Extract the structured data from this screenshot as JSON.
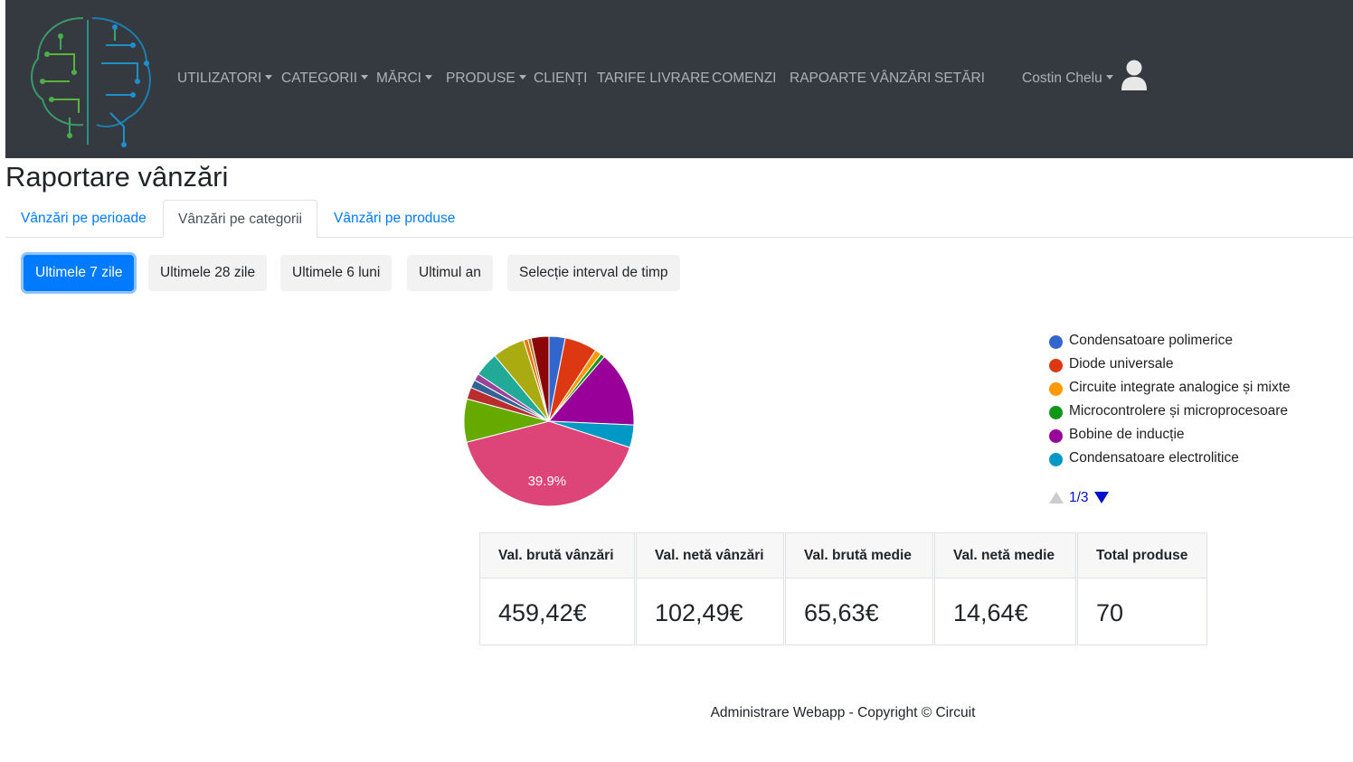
{
  "navbar": {
    "items": [
      {
        "label": "UTILIZATORI",
        "dropdown": true
      },
      {
        "label": "CATEGORII",
        "dropdown": true
      },
      {
        "label": "MĂRCI",
        "dropdown": true
      },
      {
        "label": "PRODUSE",
        "dropdown": true
      },
      {
        "label": "CLIENȚI",
        "dropdown": false
      },
      {
        "label": "TARIFE LIVRARE",
        "dropdown": false
      },
      {
        "label": "COMENZI",
        "dropdown": false
      },
      {
        "label": "RAPOARTE VÂNZĂRI",
        "dropdown": false
      },
      {
        "label": "SETĂRI",
        "dropdown": false
      }
    ],
    "user": {
      "name": "Costin Chelu",
      "icon": "user-icon"
    },
    "logo_icon": "brain-circuit-logo-icon"
  },
  "page": {
    "title": "Raportare vânzări"
  },
  "tabs": [
    {
      "label": "Vânzări pe perioade",
      "active": false
    },
    {
      "label": "Vânzări pe categorii",
      "active": true
    },
    {
      "label": "Vânzări pe produse",
      "active": false
    }
  ],
  "period_buttons": [
    {
      "label": "Ultimele 7 zile",
      "active": true
    },
    {
      "label": "Ultimele 28 zile",
      "active": false
    },
    {
      "label": "Ultimele 6 luni",
      "active": false
    },
    {
      "label": "Ultimul an",
      "active": false
    },
    {
      "label": "Selecție interval de timp",
      "active": false
    }
  ],
  "chart_data": {
    "type": "pie",
    "slice_label": "39.9%",
    "legend_position": "right",
    "legend_page": "1/3",
    "legend": [
      {
        "name": "Condensatoare polimerice",
        "color": "#3366cc"
      },
      {
        "name": "Diode universale",
        "color": "#dc3912"
      },
      {
        "name": "Circuite integrate analogice și mixte",
        "color": "#ff9900"
      },
      {
        "name": "Microcontrolere și microprocesoare",
        "color": "#109618"
      },
      {
        "name": "Bobine de inducție",
        "color": "#990099"
      },
      {
        "name": "Condensatoare electrolitice",
        "color": "#0099c6"
      }
    ],
    "slices": [
      {
        "value": 3.0,
        "color": "#3366cc"
      },
      {
        "value": 6.0,
        "color": "#dc3912"
      },
      {
        "value": 1.2,
        "color": "#ff9900"
      },
      {
        "value": 0.8,
        "color": "#109618"
      },
      {
        "value": 14.0,
        "color": "#990099"
      },
      {
        "value": 4.2,
        "color": "#0099c6"
      },
      {
        "value": 39.9,
        "color": "#dd4477"
      },
      {
        "value": 8.0,
        "color": "#66aa00"
      },
      {
        "value": 2.2,
        "color": "#b82e2e"
      },
      {
        "value": 1.5,
        "color": "#316395"
      },
      {
        "value": 1.3,
        "color": "#994499"
      },
      {
        "value": 4.5,
        "color": "#22aa99"
      },
      {
        "value": 6.0,
        "color": "#aaaa11"
      },
      {
        "value": 0.8,
        "color": "#e67300"
      },
      {
        "value": 0.6,
        "color": "#b77322"
      },
      {
        "value": 3.3,
        "color": "#8b0707"
      }
    ]
  },
  "stats": [
    {
      "label": "Val. brută vânzări",
      "value": "459,42€"
    },
    {
      "label": "Val. netă vânzări",
      "value": "102,49€"
    },
    {
      "label": "Val. brută medie",
      "value": "65,63€"
    },
    {
      "label": "Val. netă medie",
      "value": "14,64€"
    },
    {
      "label": "Total produse",
      "value": "70"
    }
  ],
  "footer": {
    "text": "Administrare Webapp - Copyright © Circuit"
  }
}
